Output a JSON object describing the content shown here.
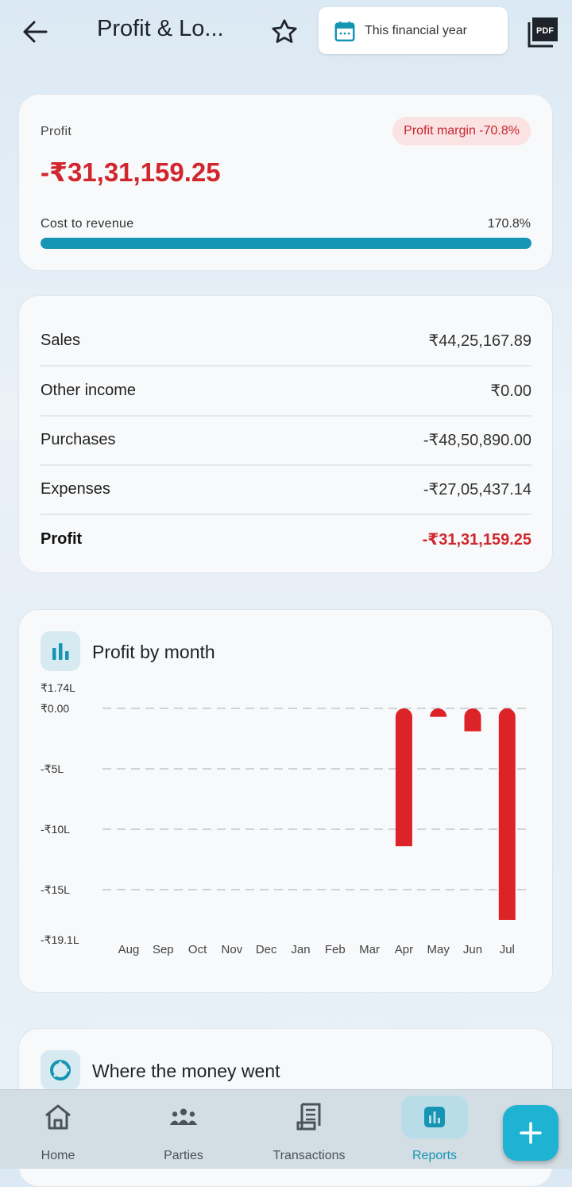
{
  "header": {
    "title": "Profit & Lo...",
    "period_label": "This financial year",
    "pdf_label": "PDF"
  },
  "profit_card": {
    "label": "Profit",
    "margin_badge": "Profit margin -70.8%",
    "amount": "-₹31,31,159.25",
    "cost_to_revenue_label": "Cost to revenue",
    "cost_to_revenue_value": "170.8%",
    "cost_to_revenue_fill": 1.0
  },
  "summary": {
    "rows": [
      {
        "label": "Sales",
        "value": "₹44,25,167.89"
      },
      {
        "label": "Other income",
        "value": "₹0.00"
      },
      {
        "label": "Purchases",
        "value": "-₹48,50,890.00"
      },
      {
        "label": "Expenses",
        "value": "-₹27,05,437.14"
      },
      {
        "label": "Profit",
        "value": "-₹31,31,159.25"
      }
    ]
  },
  "chart_section": {
    "title": "Profit by month"
  },
  "chart_data": {
    "type": "bar",
    "categories": [
      "Aug",
      "Sep",
      "Oct",
      "Nov",
      "Dec",
      "Jan",
      "Feb",
      "Mar",
      "Apr",
      "May",
      "Jun",
      "Jul"
    ],
    "values": [
      0,
      0,
      0,
      0,
      0,
      0,
      0,
      0,
      -11.4,
      -0.7,
      -1.9,
      -17.5
    ],
    "value_unit": "lakh ₹",
    "y_tick_labels": [
      "₹1.74L",
      "₹0.00",
      "-₹5L",
      "-₹10L",
      "-₹15L",
      "-₹19.1L"
    ],
    "y_tick_values": [
      1.74,
      0,
      -5,
      -10,
      -15,
      -19.1
    ],
    "ylim": [
      -19.1,
      1.74
    ],
    "grid": true,
    "bar_color": "#dc2328"
  },
  "money_section": {
    "title": "Where the money went"
  },
  "bottom_nav": {
    "items": [
      {
        "label": "Home"
      },
      {
        "label": "Parties"
      },
      {
        "label": "Transactions"
      },
      {
        "label": "Reports"
      }
    ]
  },
  "colors": {
    "accent": "#1595b3",
    "negative": "#d0262e",
    "fab": "#1eb3d3"
  }
}
